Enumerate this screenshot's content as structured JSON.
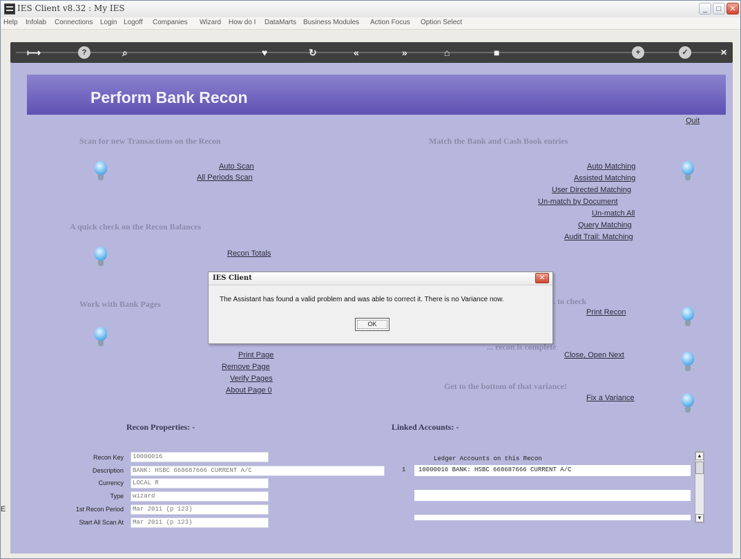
{
  "window": {
    "title": "IES Client v8.32 : My IES",
    "controls": {
      "minimize": "_",
      "maximize": "□",
      "close": "✕"
    }
  },
  "menubar": [
    "Help",
    "Infolab",
    "Connections",
    "Login",
    "Logoff",
    "Companies",
    "Wizard",
    "How do I",
    "DataMarts",
    "Business Modules",
    "Action Focus",
    "Option Select"
  ],
  "toolbar": {
    "icons": [
      "exit-icon",
      "help-icon",
      "search-icon",
      "heart-icon",
      "refresh-icon",
      "back-icon",
      "forward-icon",
      "home-icon",
      "window-icon",
      "plus-icon",
      "check-icon",
      "close-icon"
    ],
    "glyphs": {
      "exit": "⟼",
      "help": "?",
      "search": "⌕",
      "heart": "♥",
      "refresh": "↻",
      "back": "«",
      "forward": "»",
      "home": "⌂",
      "window": "■",
      "plus": "+",
      "check": "✓",
      "close": "✕"
    }
  },
  "page": {
    "title": "Perform Bank Recon",
    "quit": "Quit",
    "sections": {
      "scan": "Scan for new Transactions on the Recon",
      "match": "Match the Bank and Cash Book entries",
      "check": "A quick check on the Recon Balances",
      "pages": "Work with Bank Pages",
      "print_check": "... to check",
      "close": "... recon is complete",
      "variance": "Get to the bottom of that variance!"
    },
    "links": {
      "auto_scan": "Auto Scan",
      "all_periods_scan": "All Periods Scan",
      "auto_matching": "Auto Matching",
      "assisted_matching": "Assisted Matching",
      "user_directed_matching": "User Directed Matching",
      "unmatch_by_document": "Un-match by Document",
      "unmatch_all": "Un-match All",
      "query_matching": "Query Matching",
      "audit_trail_matching": "Audit Trail: Matching",
      "recon_totals": "Recon Totals",
      "print_recon": "Print Recon",
      "print_page": "Print Page",
      "remove_page": "Remove Page",
      "verify_pages": "Verify Pages",
      "about_page": "About Page 0",
      "close_open_next": "Close, Open Next",
      "fix_variance": "Fix a Variance"
    },
    "recon_properties": {
      "title": "Recon Properties: -",
      "fields": [
        {
          "label": "Recon Key",
          "value": "10000016"
        },
        {
          "label": "Description",
          "value": "BANK: HSBC 668687666 CURRENT A/C"
        },
        {
          "label": "Currency",
          "value": "LOCAL R"
        },
        {
          "label": "Type",
          "value": "wizard"
        },
        {
          "label": "1st Recon Period",
          "value": "Mar 2011 (p 123)"
        },
        {
          "label": "Start All Scan At",
          "value": "Mar 2011 (p 123)"
        }
      ]
    },
    "linked_accounts": {
      "title": "Linked Accounts: -",
      "header": "Ledger Accounts on this Recon",
      "rows": [
        {
          "num": "1",
          "text": "10000016 BANK: HSBC 668687666 CURRENT A/C"
        }
      ]
    }
  },
  "dialog": {
    "title": "IES Client",
    "message": "The Assistant has found a valid problem and was able to correct it.  There is no Variance now.",
    "ok": "OK",
    "close": "✕"
  }
}
